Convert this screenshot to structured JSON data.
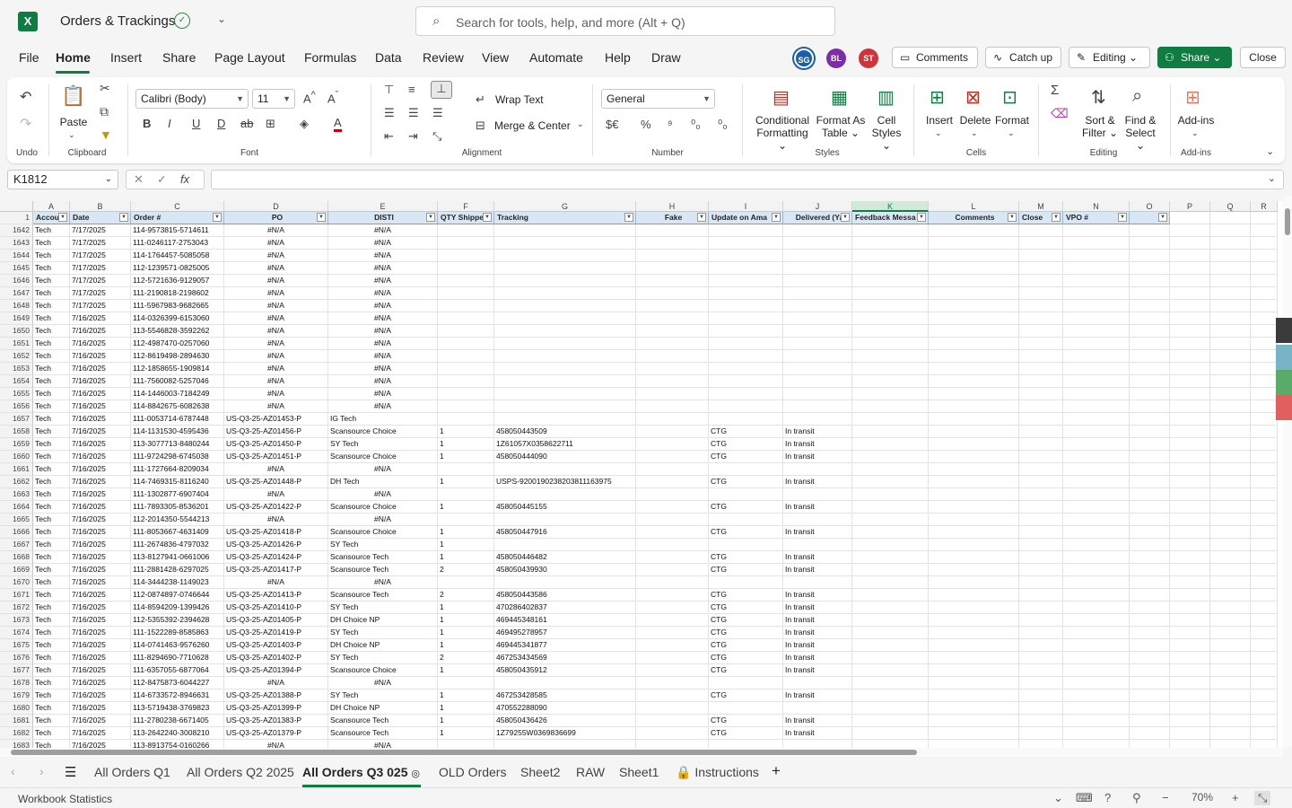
{
  "app": {
    "title": "Orders & Trackings",
    "logo": "X",
    "search_placeholder": "Search for tools, help, and more (Alt + Q)"
  },
  "menu": [
    "File",
    "Home",
    "Insert",
    "Share",
    "Page Layout",
    "Formulas",
    "Data",
    "Review",
    "View",
    "Automate",
    "Help",
    "Draw"
  ],
  "avatars": [
    {
      "initials": "SG",
      "color": "#1a5fa8"
    },
    {
      "initials": "BL",
      "color": "#7a2fa8"
    },
    {
      "initials": "ST",
      "color": "#d13438"
    }
  ],
  "top_buttons": {
    "comments": "Comments",
    "catchup": "Catch up",
    "editing": "Editing",
    "share": "Share",
    "close": "Close"
  },
  "ribbon": {
    "undo_label": "Undo",
    "clipboard": {
      "paste": "Paste",
      "label": "Clipboard"
    },
    "font": {
      "name": "Calibri (Body)",
      "size": "11",
      "label": "Font"
    },
    "alignment": {
      "wrap": "Wrap Text",
      "merge": "Merge & Center",
      "label": "Alignment"
    },
    "number": {
      "format": "General",
      "label": "Number"
    },
    "styles": {
      "cond1": "Conditional",
      "cond2": "Formatting",
      "fat1": "Format As",
      "fat2": "Table",
      "cs1": "Cell",
      "cs2": "Styles",
      "label": "Styles"
    },
    "cells": {
      "insert": "Insert",
      "delete": "Delete",
      "format": "Format",
      "label": "Cells"
    },
    "editing": {
      "sort1": "Sort &",
      "sort2": "Filter",
      "find1": "Find &",
      "find2": "Select",
      "label": "Editing"
    },
    "addins": {
      "btn": "Add-ins",
      "label": "Add-ins"
    }
  },
  "formula_bar": {
    "name_box": "K1812",
    "fx": "fx",
    "formula": ""
  },
  "columns": [
    {
      "letter": "A",
      "header": "Accou"
    },
    {
      "letter": "B",
      "header": "Date"
    },
    {
      "letter": "C",
      "header": "Order #"
    },
    {
      "letter": "D",
      "header": "PO"
    },
    {
      "letter": "E",
      "header": "DISTI"
    },
    {
      "letter": "F",
      "header": "QTY Shippe"
    },
    {
      "letter": "G",
      "header": "Tracking"
    },
    {
      "letter": "H",
      "header": "Fake"
    },
    {
      "letter": "I",
      "header": "Update on Ama"
    },
    {
      "letter": "J",
      "header": "Delivered (Y/"
    },
    {
      "letter": "K",
      "header": "Feedback Messa"
    },
    {
      "letter": "L",
      "header": "Comments"
    },
    {
      "letter": "M",
      "header": "Close"
    },
    {
      "letter": "N",
      "header": "VPO #"
    },
    {
      "letter": "O",
      "header": ""
    },
    {
      "letter": "P",
      "header": ""
    },
    {
      "letter": "Q",
      "header": ""
    },
    {
      "letter": "R",
      "header": ""
    }
  ],
  "rows": [
    [
      "1642",
      "Tech",
      "7/17/2025",
      "114-9573815-5714611",
      "#N/A",
      "#N/A",
      "",
      "",
      "",
      ""
    ],
    [
      "1643",
      "Tech",
      "7/17/2025",
      "111-0246117-2753043",
      "#N/A",
      "#N/A",
      "",
      "",
      "",
      ""
    ],
    [
      "1644",
      "Tech",
      "7/17/2025",
      "114-1764457-5085058",
      "#N/A",
      "#N/A",
      "",
      "",
      "",
      ""
    ],
    [
      "1645",
      "Tech",
      "7/17/2025",
      "112-1239571-0825005",
      "#N/A",
      "#N/A",
      "",
      "",
      "",
      ""
    ],
    [
      "1646",
      "Tech",
      "7/17/2025",
      "112-5721636-9129057",
      "#N/A",
      "#N/A",
      "",
      "",
      "",
      ""
    ],
    [
      "1647",
      "Tech",
      "7/17/2025",
      "111-2190818-2198602",
      "#N/A",
      "#N/A",
      "",
      "",
      "",
      ""
    ],
    [
      "1648",
      "Tech",
      "7/17/2025",
      "111-5967983-9682665",
      "#N/A",
      "#N/A",
      "",
      "",
      "",
      ""
    ],
    [
      "1649",
      "Tech",
      "7/16/2025",
      "114-0326399-6153060",
      "#N/A",
      "#N/A",
      "",
      "",
      "",
      ""
    ],
    [
      "1650",
      "Tech",
      "7/16/2025",
      "113-5546828-3592262",
      "#N/A",
      "#N/A",
      "",
      "",
      "",
      ""
    ],
    [
      "1651",
      "Tech",
      "7/16/2025",
      "112-4987470-0257060",
      "#N/A",
      "#N/A",
      "",
      "",
      "",
      ""
    ],
    [
      "1652",
      "Tech",
      "7/16/2025",
      "112-8619498-2894630",
      "#N/A",
      "#N/A",
      "",
      "",
      "",
      ""
    ],
    [
      "1653",
      "Tech",
      "7/16/2025",
      "112-1858655-1909814",
      "#N/A",
      "#N/A",
      "",
      "",
      "",
      ""
    ],
    [
      "1654",
      "Tech",
      "7/16/2025",
      "111-7560082-5257046",
      "#N/A",
      "#N/A",
      "",
      "",
      "",
      ""
    ],
    [
      "1655",
      "Tech",
      "7/16/2025",
      "114-1446003-7184249",
      "#N/A",
      "#N/A",
      "",
      "",
      "",
      ""
    ],
    [
      "1656",
      "Tech",
      "7/16/2025",
      "114-8842675-6082638",
      "#N/A",
      "#N/A",
      "",
      "",
      "",
      ""
    ],
    [
      "1657",
      "Tech",
      "7/16/2025",
      "111-0053714-6787448",
      "US-Q3-25-AZ01453-P",
      "IG Tech",
      "",
      "",
      "",
      ""
    ],
    [
      "1658",
      "Tech",
      "7/16/2025",
      "114-1131530-4595436",
      "US-Q3-25-AZ01456-P",
      "Scansource Choice",
      "1",
      "458050443509",
      "CTG",
      "In transit"
    ],
    [
      "1659",
      "Tech",
      "7/16/2025",
      "113-3077713-8480244",
      "US-Q3-25-AZ01450-P",
      "SY Tech",
      "1",
      "1Z61057X0358622711",
      "CTG",
      "In transit"
    ],
    [
      "1660",
      "Tech",
      "7/16/2025",
      "111-9724298-6745038",
      "US-Q3-25-AZ01451-P",
      "Scansource Choice",
      "1",
      "458050444090",
      "CTG",
      "In transit"
    ],
    [
      "1661",
      "Tech",
      "7/16/2025",
      "111-1727664-8209034",
      "#N/A",
      "#N/A",
      "",
      "",
      "",
      ""
    ],
    [
      "1662",
      "Tech",
      "7/16/2025",
      "114-7469315-8116240",
      "US-Q3-25-AZ01448-P",
      "DH Tech",
      "1",
      "USPS-9200190238203811163975",
      "CTG",
      "In transit"
    ],
    [
      "1663",
      "Tech",
      "7/16/2025",
      "111-1302877-6907404",
      "#N/A",
      "#N/A",
      "",
      "",
      "",
      ""
    ],
    [
      "1664",
      "Tech",
      "7/16/2025",
      "111-7893305-8536201",
      "US-Q3-25-AZ01422-P",
      "Scansource Choice",
      "1",
      "458050445155",
      "CTG",
      "In transit"
    ],
    [
      "1665",
      "Tech",
      "7/16/2025",
      "112-2014350-5544213",
      "#N/A",
      "#N/A",
      "",
      "",
      "",
      ""
    ],
    [
      "1666",
      "Tech",
      "7/16/2025",
      "111-8053667-4631409",
      "US-Q3-25-AZ01418-P",
      "Scansource Choice",
      "1",
      "458050447916",
      "CTG",
      "In transit"
    ],
    [
      "1667",
      "Tech",
      "7/16/2025",
      "111-2674836-4797032",
      "US-Q3-25-AZ01426-P",
      "SY Tech",
      "1",
      "",
      "",
      ""
    ],
    [
      "1668",
      "Tech",
      "7/16/2025",
      "113-8127941-0661006",
      "US-Q3-25-AZ01424-P",
      "Scansource Tech",
      "1",
      "458050446482",
      "CTG",
      "In transit"
    ],
    [
      "1669",
      "Tech",
      "7/16/2025",
      "111-2881428-6297025",
      "US-Q3-25-AZ01417-P",
      "Scansource Tech",
      "2",
      "458050439930",
      "CTG",
      "In transit"
    ],
    [
      "1670",
      "Tech",
      "7/16/2025",
      "114-3444238-1149023",
      "#N/A",
      "#N/A",
      "",
      "",
      "",
      ""
    ],
    [
      "1671",
      "Tech",
      "7/16/2025",
      "112-0874897-0746644",
      "US-Q3-25-AZ01413-P",
      "Scansource Tech",
      "2",
      "458050443586",
      "CTG",
      "In transit"
    ],
    [
      "1672",
      "Tech",
      "7/16/2025",
      "114-8594209-1399426",
      "US-Q3-25-AZ01410-P",
      "SY Tech",
      "1",
      "470286402837",
      "CTG",
      "In transit"
    ],
    [
      "1673",
      "Tech",
      "7/16/2025",
      "112-5355392-2394628",
      "US-Q3-25-AZ01405-P",
      "DH Choice NP",
      "1",
      "469445348161",
      "CTG",
      "In transit"
    ],
    [
      "1674",
      "Tech",
      "7/16/2025",
      "111-1522289-8585863",
      "US-Q3-25-AZ01419-P",
      "SY Tech",
      "1",
      "469495278957",
      "CTG",
      "In transit"
    ],
    [
      "1675",
      "Tech",
      "7/16/2025",
      "114-0741463-9576260",
      "US-Q3-25-AZ01403-P",
      "DH Choice NP",
      "1",
      "469445341877",
      "CTG",
      "In transit"
    ],
    [
      "1676",
      "Tech",
      "7/16/2025",
      "111-8294690-7710628",
      "US-Q3-25-AZ01402-P",
      "SY Tech",
      "2",
      "467253434569",
      "CTG",
      "In transit"
    ],
    [
      "1677",
      "Tech",
      "7/16/2025",
      "111-6357055-6877064",
      "US-Q3-25-AZ01394-P",
      "Scansource Choice",
      "1",
      "458050435912",
      "CTG",
      "In transit"
    ],
    [
      "1678",
      "Tech",
      "7/16/2025",
      "112-8475873-6044227",
      "#N/A",
      "#N/A",
      "",
      "",
      "",
      ""
    ],
    [
      "1679",
      "Tech",
      "7/16/2025",
      "114-6733572-8946631",
      "US-Q3-25-AZ01388-P",
      "SY Tech",
      "1",
      "467253428585",
      "CTG",
      "In transit"
    ],
    [
      "1680",
      "Tech",
      "7/16/2025",
      "113-5719438-3769823",
      "US-Q3-25-AZ01399-P",
      "DH Choice NP",
      "1",
      "470552288090",
      "",
      ""
    ],
    [
      "1681",
      "Tech",
      "7/16/2025",
      "111-2780238-6671405",
      "US-Q3-25-AZ01383-P",
      "Scansource Tech",
      "1",
      "458050436426",
      "CTG",
      "In transit"
    ],
    [
      "1682",
      "Tech",
      "7/16/2025",
      "113-2642240-3008210",
      "US-Q3-25-AZ01379-P",
      "Scansource Tech",
      "1",
      "1Z79255W0369836699",
      "CTG",
      "In transit"
    ],
    [
      "1683",
      "Tech",
      "7/16/2025",
      "113-8913754-0160266",
      "#N/A",
      "#N/A",
      "",
      "",
      "",
      ""
    ]
  ],
  "sheets": [
    "All Orders Q1",
    "All Orders Q2 2025",
    "All Orders Q3 025",
    "OLD Orders",
    "Sheet2",
    "RAW",
    "Sheet1",
    "Instructions"
  ],
  "status": {
    "text": "Workbook Statistics",
    "zoom": "70%"
  },
  "colors": {
    "accent": "#107c41",
    "header_fill": "#d9e7f5"
  }
}
